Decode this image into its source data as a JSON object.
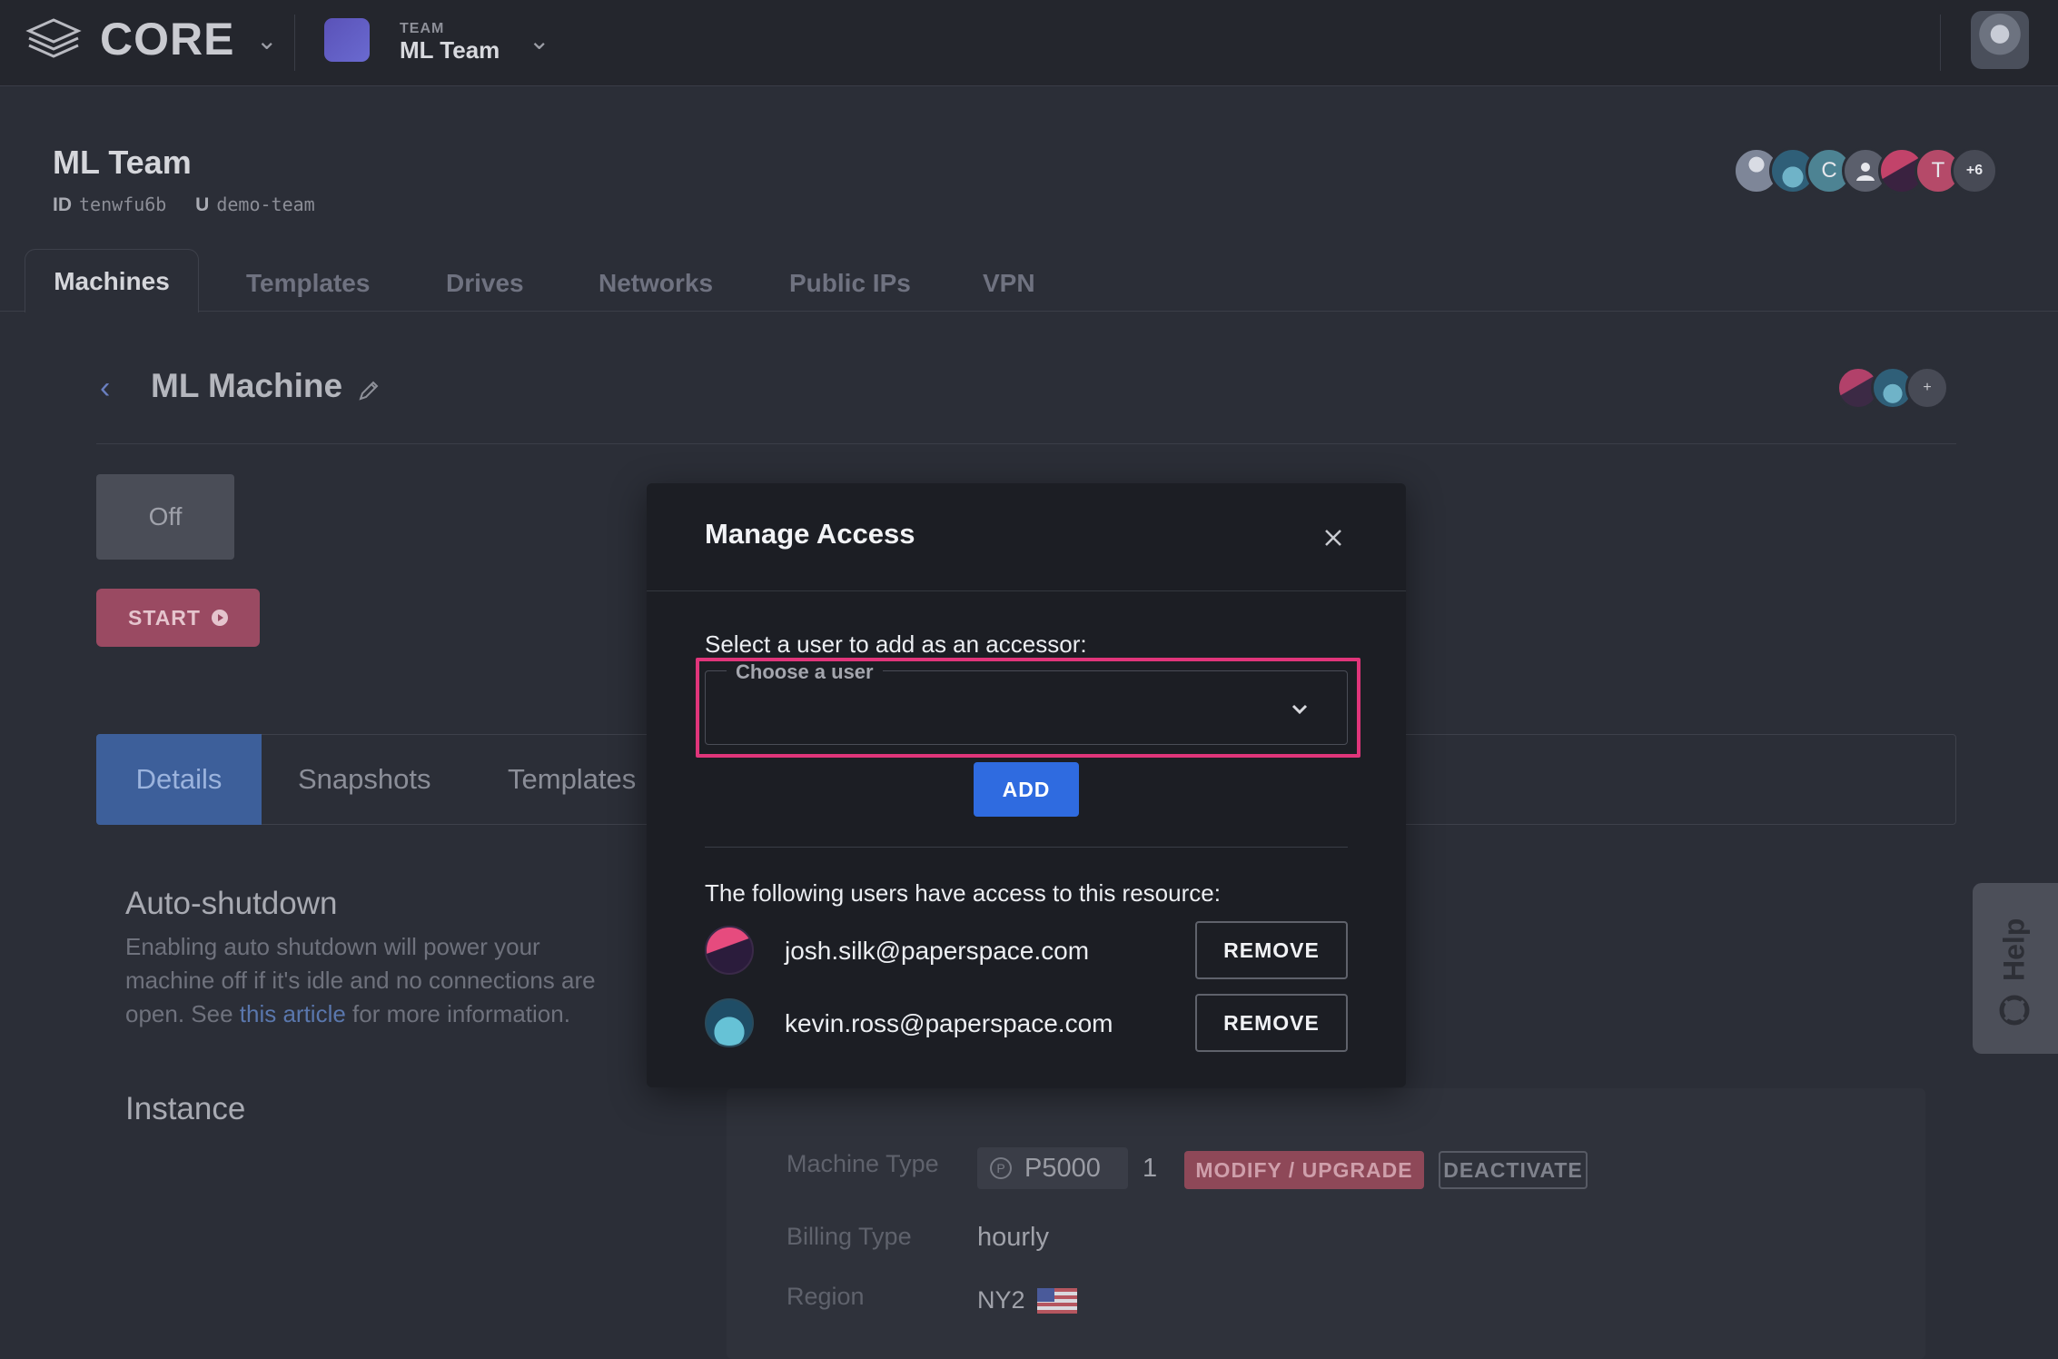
{
  "topbar": {
    "product": "CORE",
    "team_caption": "TEAM",
    "team_name": "ML Team"
  },
  "team": {
    "title": "ML Team",
    "id_label": "ID",
    "id_value": "tenwfu6b",
    "user_label": "U",
    "user_value": "demo-team",
    "member_initials": [
      "C",
      "T"
    ],
    "extra_members": "+6"
  },
  "tabs": [
    "Machines",
    "Templates",
    "Drives",
    "Networks",
    "Public IPs",
    "VPN"
  ],
  "machine": {
    "name": "ML Machine",
    "state": "Off",
    "start_label": "START",
    "shared_more": "+"
  },
  "detail_tabs": [
    "Details",
    "Snapshots",
    "Templates"
  ],
  "auto_shutdown": {
    "title": "Auto-shutdown",
    "desc_line1": "Enabling auto shutdown will power your",
    "desc_line2": "machine off if it's idle and no connections are",
    "desc_pre": "open. See ",
    "link_text": "this article",
    "desc_post": " for more information."
  },
  "instance": {
    "title": "Instance",
    "machine_type_label": "Machine Type",
    "gpu_icon_letter": "P",
    "gpu": "P5000",
    "gpu_count": "1",
    "modify_label": "MODIFY / UPGRADE",
    "deactivate_label": "DEACTIVATE",
    "billing_label": "Billing Type",
    "billing_value": "hourly",
    "region_label": "Region",
    "region_value": "NY2"
  },
  "help": {
    "label": "Help"
  },
  "modal": {
    "title": "Manage Access",
    "select_label": "Select a user to add as an accessor:",
    "select_legend": "Choose a user",
    "add_label": "ADD",
    "access_label": "The following users have access to this resource:",
    "users": [
      {
        "email": "josh.silk@paperspace.com",
        "remove_label": "REMOVE"
      },
      {
        "email": "kevin.ross@paperspace.com",
        "remove_label": "REMOVE"
      }
    ]
  },
  "colors": {
    "accent_blue": "#2f6be0",
    "highlight_pink": "#e0357a",
    "start_red": "#9a4a62"
  },
  "icons": [
    "core-logo-icon",
    "chevron-down-icon",
    "pencil-icon",
    "close-icon",
    "lifebuoy-icon",
    "play-icon",
    "us-flag-icon"
  ]
}
